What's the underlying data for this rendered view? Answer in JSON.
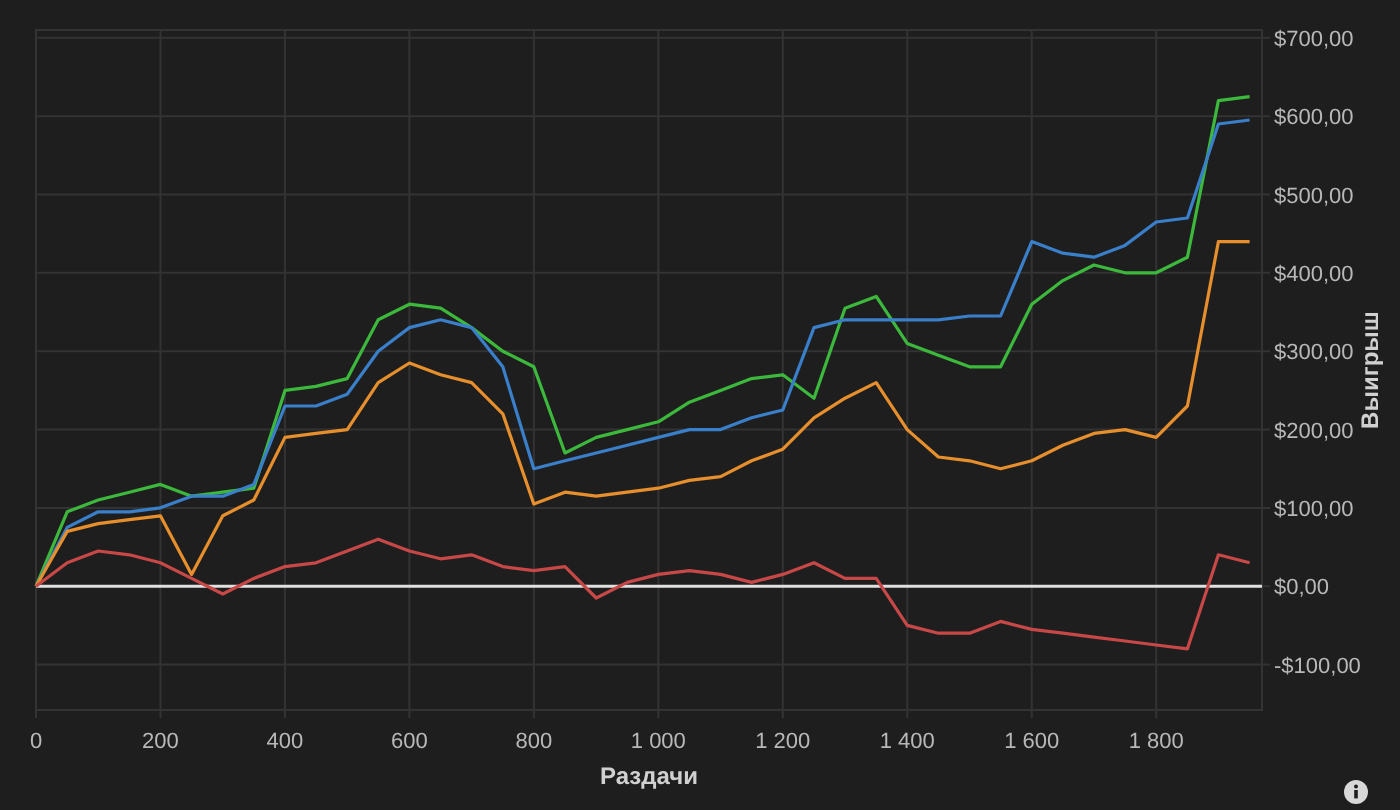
{
  "chart_data": {
    "type": "line",
    "grid": true,
    "xlabel": "Раздачи",
    "ylabel": "Выигрыш",
    "x": [
      0,
      50,
      100,
      150,
      200,
      250,
      300,
      350,
      400,
      450,
      500,
      550,
      600,
      650,
      700,
      750,
      800,
      850,
      900,
      950,
      1000,
      1050,
      1100,
      1150,
      1200,
      1250,
      1300,
      1350,
      1400,
      1450,
      1500,
      1550,
      1600,
      1650,
      1700,
      1750,
      1800,
      1850,
      1900,
      1950
    ],
    "series": [
      {
        "color": "#3cb83c",
        "values": [
          0,
          95,
          110,
          120,
          130,
          115,
          120,
          125,
          250,
          255,
          265,
          340,
          360,
          355,
          330,
          300,
          280,
          170,
          190,
          200,
          210,
          235,
          250,
          265,
          270,
          240,
          355,
          370,
          310,
          295,
          280,
          280,
          360,
          390,
          410,
          400,
          400,
          420,
          620,
          625
        ]
      },
      {
        "color": "#3a7fca",
        "values": [
          0,
          75,
          95,
          95,
          100,
          115,
          115,
          130,
          230,
          230,
          245,
          300,
          330,
          340,
          330,
          280,
          150,
          160,
          170,
          180,
          190,
          200,
          200,
          215,
          225,
          330,
          340,
          340,
          340,
          340,
          345,
          345,
          440,
          425,
          420,
          435,
          465,
          470,
          590,
          595
        ]
      },
      {
        "color": "#e68f2c",
        "values": [
          0,
          70,
          80,
          85,
          90,
          15,
          90,
          110,
          190,
          195,
          200,
          260,
          285,
          270,
          260,
          220,
          105,
          120,
          115,
          120,
          125,
          135,
          140,
          160,
          175,
          215,
          240,
          260,
          200,
          165,
          160,
          150,
          160,
          180,
          195,
          200,
          190,
          230,
          440,
          440
        ]
      },
      {
        "color": "#c84848",
        "values": [
          0,
          30,
          45,
          40,
          30,
          10,
          -10,
          10,
          25,
          30,
          45,
          60,
          45,
          35,
          40,
          25,
          20,
          25,
          -15,
          5,
          15,
          20,
          15,
          5,
          15,
          30,
          10,
          10,
          -50,
          -60,
          -60,
          -45,
          -55,
          -60,
          -65,
          -70,
          -75,
          -80,
          40,
          30
        ]
      }
    ],
    "xlim": [
      0,
      1970
    ],
    "ylim": [
      -158,
      710
    ],
    "xticks": [
      {
        "value": 0,
        "label": "0"
      },
      {
        "value": 200,
        "label": "200"
      },
      {
        "value": 400,
        "label": "400"
      },
      {
        "value": 600,
        "label": "600"
      },
      {
        "value": 800,
        "label": "800"
      },
      {
        "value": 1000,
        "label": "1 000"
      },
      {
        "value": 1200,
        "label": "1 200"
      },
      {
        "value": 1400,
        "label": "1 400"
      },
      {
        "value": 1600,
        "label": "1 600"
      },
      {
        "value": 1800,
        "label": "1 800"
      }
    ],
    "yticks": [
      {
        "value": 700,
        "label": "$700,00"
      },
      {
        "value": 600,
        "label": "$600,00"
      },
      {
        "value": 500,
        "label": "$500,00"
      },
      {
        "value": 400,
        "label": "$400,00"
      },
      {
        "value": 300,
        "label": "$300,00"
      },
      {
        "value": 200,
        "label": "$200,00"
      },
      {
        "value": 100,
        "label": "$100,00"
      },
      {
        "value": 0,
        "label": "$0,00"
      },
      {
        "value": -100,
        "label": "-$100,00"
      }
    ]
  }
}
